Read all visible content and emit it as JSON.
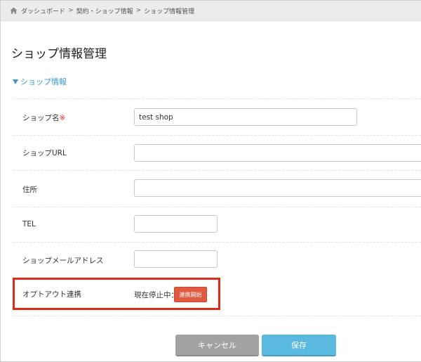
{
  "breadcrumb": {
    "items": [
      "ダッシュボード",
      "契約・ショップ情報",
      "ショップ情報管理"
    ],
    "separator": ">"
  },
  "page": {
    "title": "ショップ情報管理"
  },
  "section": {
    "toggle_label": "ショップ情報",
    "expanded": true
  },
  "form": {
    "shop_name": {
      "label": "ショップ名",
      "required_mark": "※",
      "value": "test shop"
    },
    "shop_url": {
      "label": "ショップURL",
      "value": ""
    },
    "address": {
      "label": "住所",
      "value": ""
    },
    "tel": {
      "label": "TEL",
      "value": ""
    },
    "shop_email": {
      "label": "ショップメールアドレス",
      "value": ""
    },
    "opt_out": {
      "label": "オプトアウト連携",
      "status": "現在停止中：",
      "button_label": "連携開始"
    }
  },
  "actions": {
    "cancel_label": "キャンセル",
    "save_label": "保存"
  },
  "colors": {
    "accent": "#3a97c9",
    "save": "#5bb8de",
    "cancel": "#a2a2a2",
    "connect": "#e05a3f",
    "highlight": "#e02a18",
    "required": "#dd3333"
  }
}
